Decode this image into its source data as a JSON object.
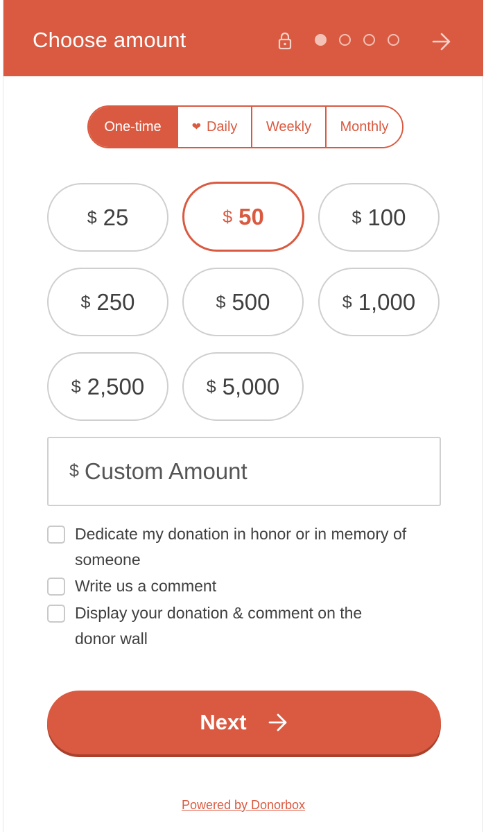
{
  "header": {
    "title": "Choose amount",
    "icons": {
      "lock": "lock-icon",
      "next": "arrow-right-icon"
    },
    "steps_total": 4,
    "current_step": 1
  },
  "frequency": {
    "tabs": [
      {
        "label": "One-time",
        "icon": "",
        "active": true
      },
      {
        "label": "Daily",
        "icon": "heart-icon",
        "active": false
      },
      {
        "label": "Weekly",
        "icon": "",
        "active": false
      },
      {
        "label": "Monthly",
        "icon": "",
        "active": false
      }
    ]
  },
  "amounts": {
    "currency": "$",
    "options": [
      "25",
      "50",
      "100",
      "250",
      "500",
      "1,000",
      "2,500",
      "5,000"
    ],
    "selected": "50"
  },
  "custom_amount": {
    "currency": "$",
    "placeholder": "Custom Amount",
    "value": ""
  },
  "options": {
    "dedicate": "Dedicate my donation in honor or in memory of someone",
    "comment": "Write us a comment",
    "donor_wall": "Display your donation & comment on the donor wall"
  },
  "next_button": {
    "label": "Next",
    "icon": "arrow-right-icon"
  },
  "footer": {
    "powered_by": "Powered by Donorbox"
  },
  "colors": {
    "accent": "#d95a41",
    "dot_light": "#f3c1b5",
    "border_gray": "#cfcfcf",
    "text": "#3f3f3f"
  }
}
